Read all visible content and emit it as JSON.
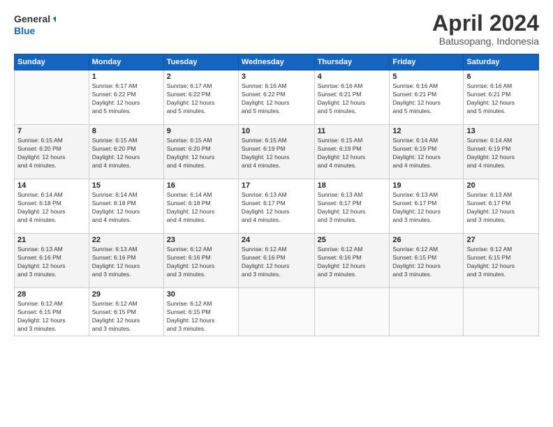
{
  "logo": {
    "line1": "General",
    "line2": "Blue"
  },
  "title": "April 2024",
  "subtitle": "Batusopang, Indonesia",
  "days_of_week": [
    "Sunday",
    "Monday",
    "Tuesday",
    "Wednesday",
    "Thursday",
    "Friday",
    "Saturday"
  ],
  "weeks": [
    [
      {
        "day": "",
        "info": ""
      },
      {
        "day": "1",
        "info": "Sunrise: 6:17 AM\nSunset: 6:22 PM\nDaylight: 12 hours\nand 5 minutes."
      },
      {
        "day": "2",
        "info": "Sunrise: 6:17 AM\nSunset: 6:22 PM\nDaylight: 12 hours\nand 5 minutes."
      },
      {
        "day": "3",
        "info": "Sunrise: 6:16 AM\nSunset: 6:22 PM\nDaylight: 12 hours\nand 5 minutes."
      },
      {
        "day": "4",
        "info": "Sunrise: 6:16 AM\nSunset: 6:21 PM\nDaylight: 12 hours\nand 5 minutes."
      },
      {
        "day": "5",
        "info": "Sunrise: 6:16 AM\nSunset: 6:21 PM\nDaylight: 12 hours\nand 5 minutes."
      },
      {
        "day": "6",
        "info": "Sunrise: 6:16 AM\nSunset: 6:21 PM\nDaylight: 12 hours\nand 5 minutes."
      }
    ],
    [
      {
        "day": "7",
        "info": "Sunrise: 6:15 AM\nSunset: 6:20 PM\nDaylight: 12 hours\nand 4 minutes."
      },
      {
        "day": "8",
        "info": "Sunrise: 6:15 AM\nSunset: 6:20 PM\nDaylight: 12 hours\nand 4 minutes."
      },
      {
        "day": "9",
        "info": "Sunrise: 6:15 AM\nSunset: 6:20 PM\nDaylight: 12 hours\nand 4 minutes."
      },
      {
        "day": "10",
        "info": "Sunrise: 6:15 AM\nSunset: 6:19 PM\nDaylight: 12 hours\nand 4 minutes."
      },
      {
        "day": "11",
        "info": "Sunrise: 6:15 AM\nSunset: 6:19 PM\nDaylight: 12 hours\nand 4 minutes."
      },
      {
        "day": "12",
        "info": "Sunrise: 6:14 AM\nSunset: 6:19 PM\nDaylight: 12 hours\nand 4 minutes."
      },
      {
        "day": "13",
        "info": "Sunrise: 6:14 AM\nSunset: 6:19 PM\nDaylight: 12 hours\nand 4 minutes."
      }
    ],
    [
      {
        "day": "14",
        "info": "Sunrise: 6:14 AM\nSunset: 6:18 PM\nDaylight: 12 hours\nand 4 minutes."
      },
      {
        "day": "15",
        "info": "Sunrise: 6:14 AM\nSunset: 6:18 PM\nDaylight: 12 hours\nand 4 minutes."
      },
      {
        "day": "16",
        "info": "Sunrise: 6:14 AM\nSunset: 6:18 PM\nDaylight: 12 hours\nand 4 minutes."
      },
      {
        "day": "17",
        "info": "Sunrise: 6:13 AM\nSunset: 6:17 PM\nDaylight: 12 hours\nand 4 minutes."
      },
      {
        "day": "18",
        "info": "Sunrise: 6:13 AM\nSunset: 6:17 PM\nDaylight: 12 hours\nand 3 minutes."
      },
      {
        "day": "19",
        "info": "Sunrise: 6:13 AM\nSunset: 6:17 PM\nDaylight: 12 hours\nand 3 minutes."
      },
      {
        "day": "20",
        "info": "Sunrise: 6:13 AM\nSunset: 6:17 PM\nDaylight: 12 hours\nand 3 minutes."
      }
    ],
    [
      {
        "day": "21",
        "info": "Sunrise: 6:13 AM\nSunset: 6:16 PM\nDaylight: 12 hours\nand 3 minutes."
      },
      {
        "day": "22",
        "info": "Sunrise: 6:13 AM\nSunset: 6:16 PM\nDaylight: 12 hours\nand 3 minutes."
      },
      {
        "day": "23",
        "info": "Sunrise: 6:12 AM\nSunset: 6:16 PM\nDaylight: 12 hours\nand 3 minutes."
      },
      {
        "day": "24",
        "info": "Sunrise: 6:12 AM\nSunset: 6:16 PM\nDaylight: 12 hours\nand 3 minutes."
      },
      {
        "day": "25",
        "info": "Sunrise: 6:12 AM\nSunset: 6:16 PM\nDaylight: 12 hours\nand 3 minutes."
      },
      {
        "day": "26",
        "info": "Sunrise: 6:12 AM\nSunset: 6:15 PM\nDaylight: 12 hours\nand 3 minutes."
      },
      {
        "day": "27",
        "info": "Sunrise: 6:12 AM\nSunset: 6:15 PM\nDaylight: 12 hours\nand 3 minutes."
      }
    ],
    [
      {
        "day": "28",
        "info": "Sunrise: 6:12 AM\nSunset: 6:15 PM\nDaylight: 12 hours\nand 3 minutes."
      },
      {
        "day": "29",
        "info": "Sunrise: 6:12 AM\nSunset: 6:15 PM\nDaylight: 12 hours\nand 3 minutes."
      },
      {
        "day": "30",
        "info": "Sunrise: 6:12 AM\nSunset: 6:15 PM\nDaylight: 12 hours\nand 3 minutes."
      },
      {
        "day": "",
        "info": ""
      },
      {
        "day": "",
        "info": ""
      },
      {
        "day": "",
        "info": ""
      },
      {
        "day": "",
        "info": ""
      }
    ]
  ]
}
